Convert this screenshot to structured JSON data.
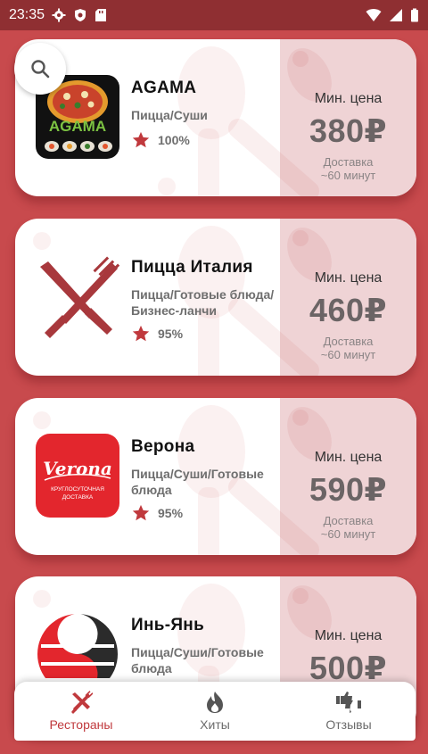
{
  "status_bar": {
    "time": "23:35",
    "icons": [
      "gear-icon",
      "shield-icon",
      "sd-card-icon"
    ],
    "right_icons": [
      "wifi-icon",
      "signal-icon",
      "battery-icon"
    ]
  },
  "search": {
    "icon": "search-icon"
  },
  "restaurants": [
    {
      "name": "AGAMA",
      "logo_text": "AGAMA",
      "categories": "Пицца/Суши",
      "rating": "100%",
      "min_price_label": "Мин. цена",
      "min_price": "380₽",
      "delivery": "Доставка",
      "delivery_time": "~60 минут"
    },
    {
      "name": "Пицца Италия",
      "categories": "Пицца/Готовые блюда/Бизнес-ланчи",
      "rating": "95%",
      "min_price_label": "Мин. цена",
      "min_price": "460₽",
      "delivery": "Доставка",
      "delivery_time": "~60 минут"
    },
    {
      "name": "Верона",
      "logo_text": "Verona",
      "logo_subtext": "КРУГЛОСУТОЧНАЯ ДОСТАВКА",
      "categories": "Пицца/Суши/Готовые блюда",
      "rating": "95%",
      "min_price_label": "Мин. цена",
      "min_price": "590₽",
      "delivery": "Доставка",
      "delivery_time": "~60 минут"
    },
    {
      "name": "Инь-Янь",
      "categories": "Пицца/Суши/Готовые блюда",
      "min_price_label": "Мин. цена",
      "min_price": "500₽"
    }
  ],
  "bottom_nav": [
    {
      "label": "Рестораны",
      "icon": "fork-knife-icon",
      "active": true
    },
    {
      "label": "Хиты",
      "icon": "flame-icon",
      "active": false
    },
    {
      "label": "Отзывы",
      "icon": "thumbs-icon",
      "active": false
    }
  ],
  "colors": {
    "background": "#c84a4d",
    "status_bar": "#8f2f32",
    "price_panel": "#efd3d5",
    "accent": "#c0393d"
  }
}
